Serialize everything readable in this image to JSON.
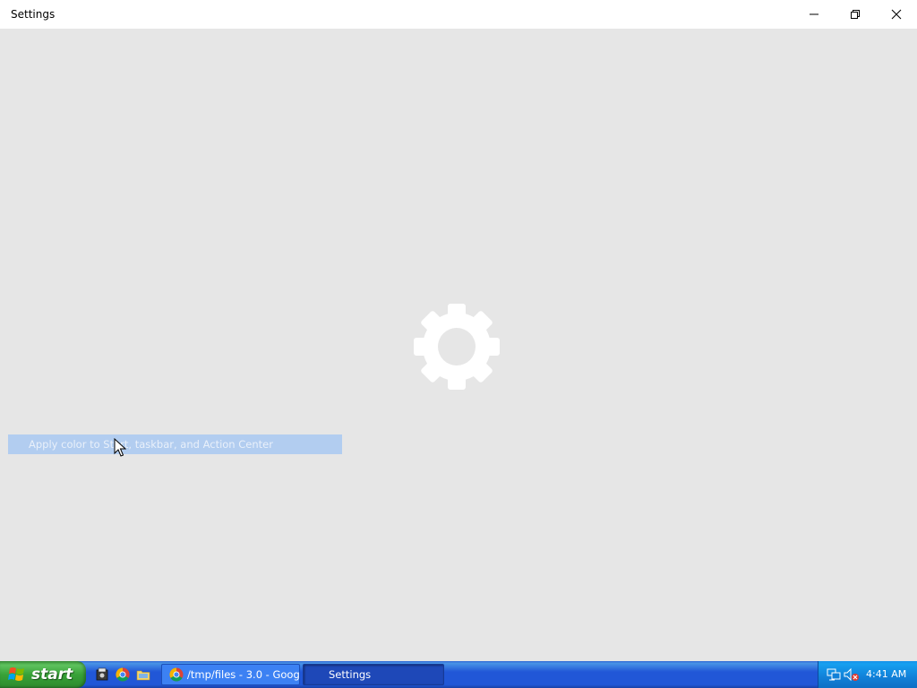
{
  "window": {
    "title": "Settings",
    "minimize_label": "Minimize",
    "maximize_label": "Restore",
    "close_label": "Close"
  },
  "content": {
    "loading_icon": "gear-icon",
    "ghost_option_label": "Apply color to Start, taskbar, and Action Center"
  },
  "taskbar": {
    "start_label": "start",
    "quicklaunch": [
      {
        "name": "media-icon"
      },
      {
        "name": "chrome-icon"
      },
      {
        "name": "folder-icon"
      }
    ],
    "tasks": [
      {
        "label": "/tmp/files - 3.0 - Googl...",
        "icon": "chrome-icon",
        "active": false
      },
      {
        "label": "Settings",
        "icon": "",
        "active": true
      }
    ],
    "tray": {
      "icons": [
        "network-icon",
        "volume-muted-icon"
      ],
      "clock": "4:41 AM"
    }
  },
  "colors": {
    "background": "#e6e6e6",
    "titlebar": "#ffffff",
    "taskbar": "#2157d7",
    "start_button": "#38a238",
    "selection": "#b2cdf0"
  }
}
